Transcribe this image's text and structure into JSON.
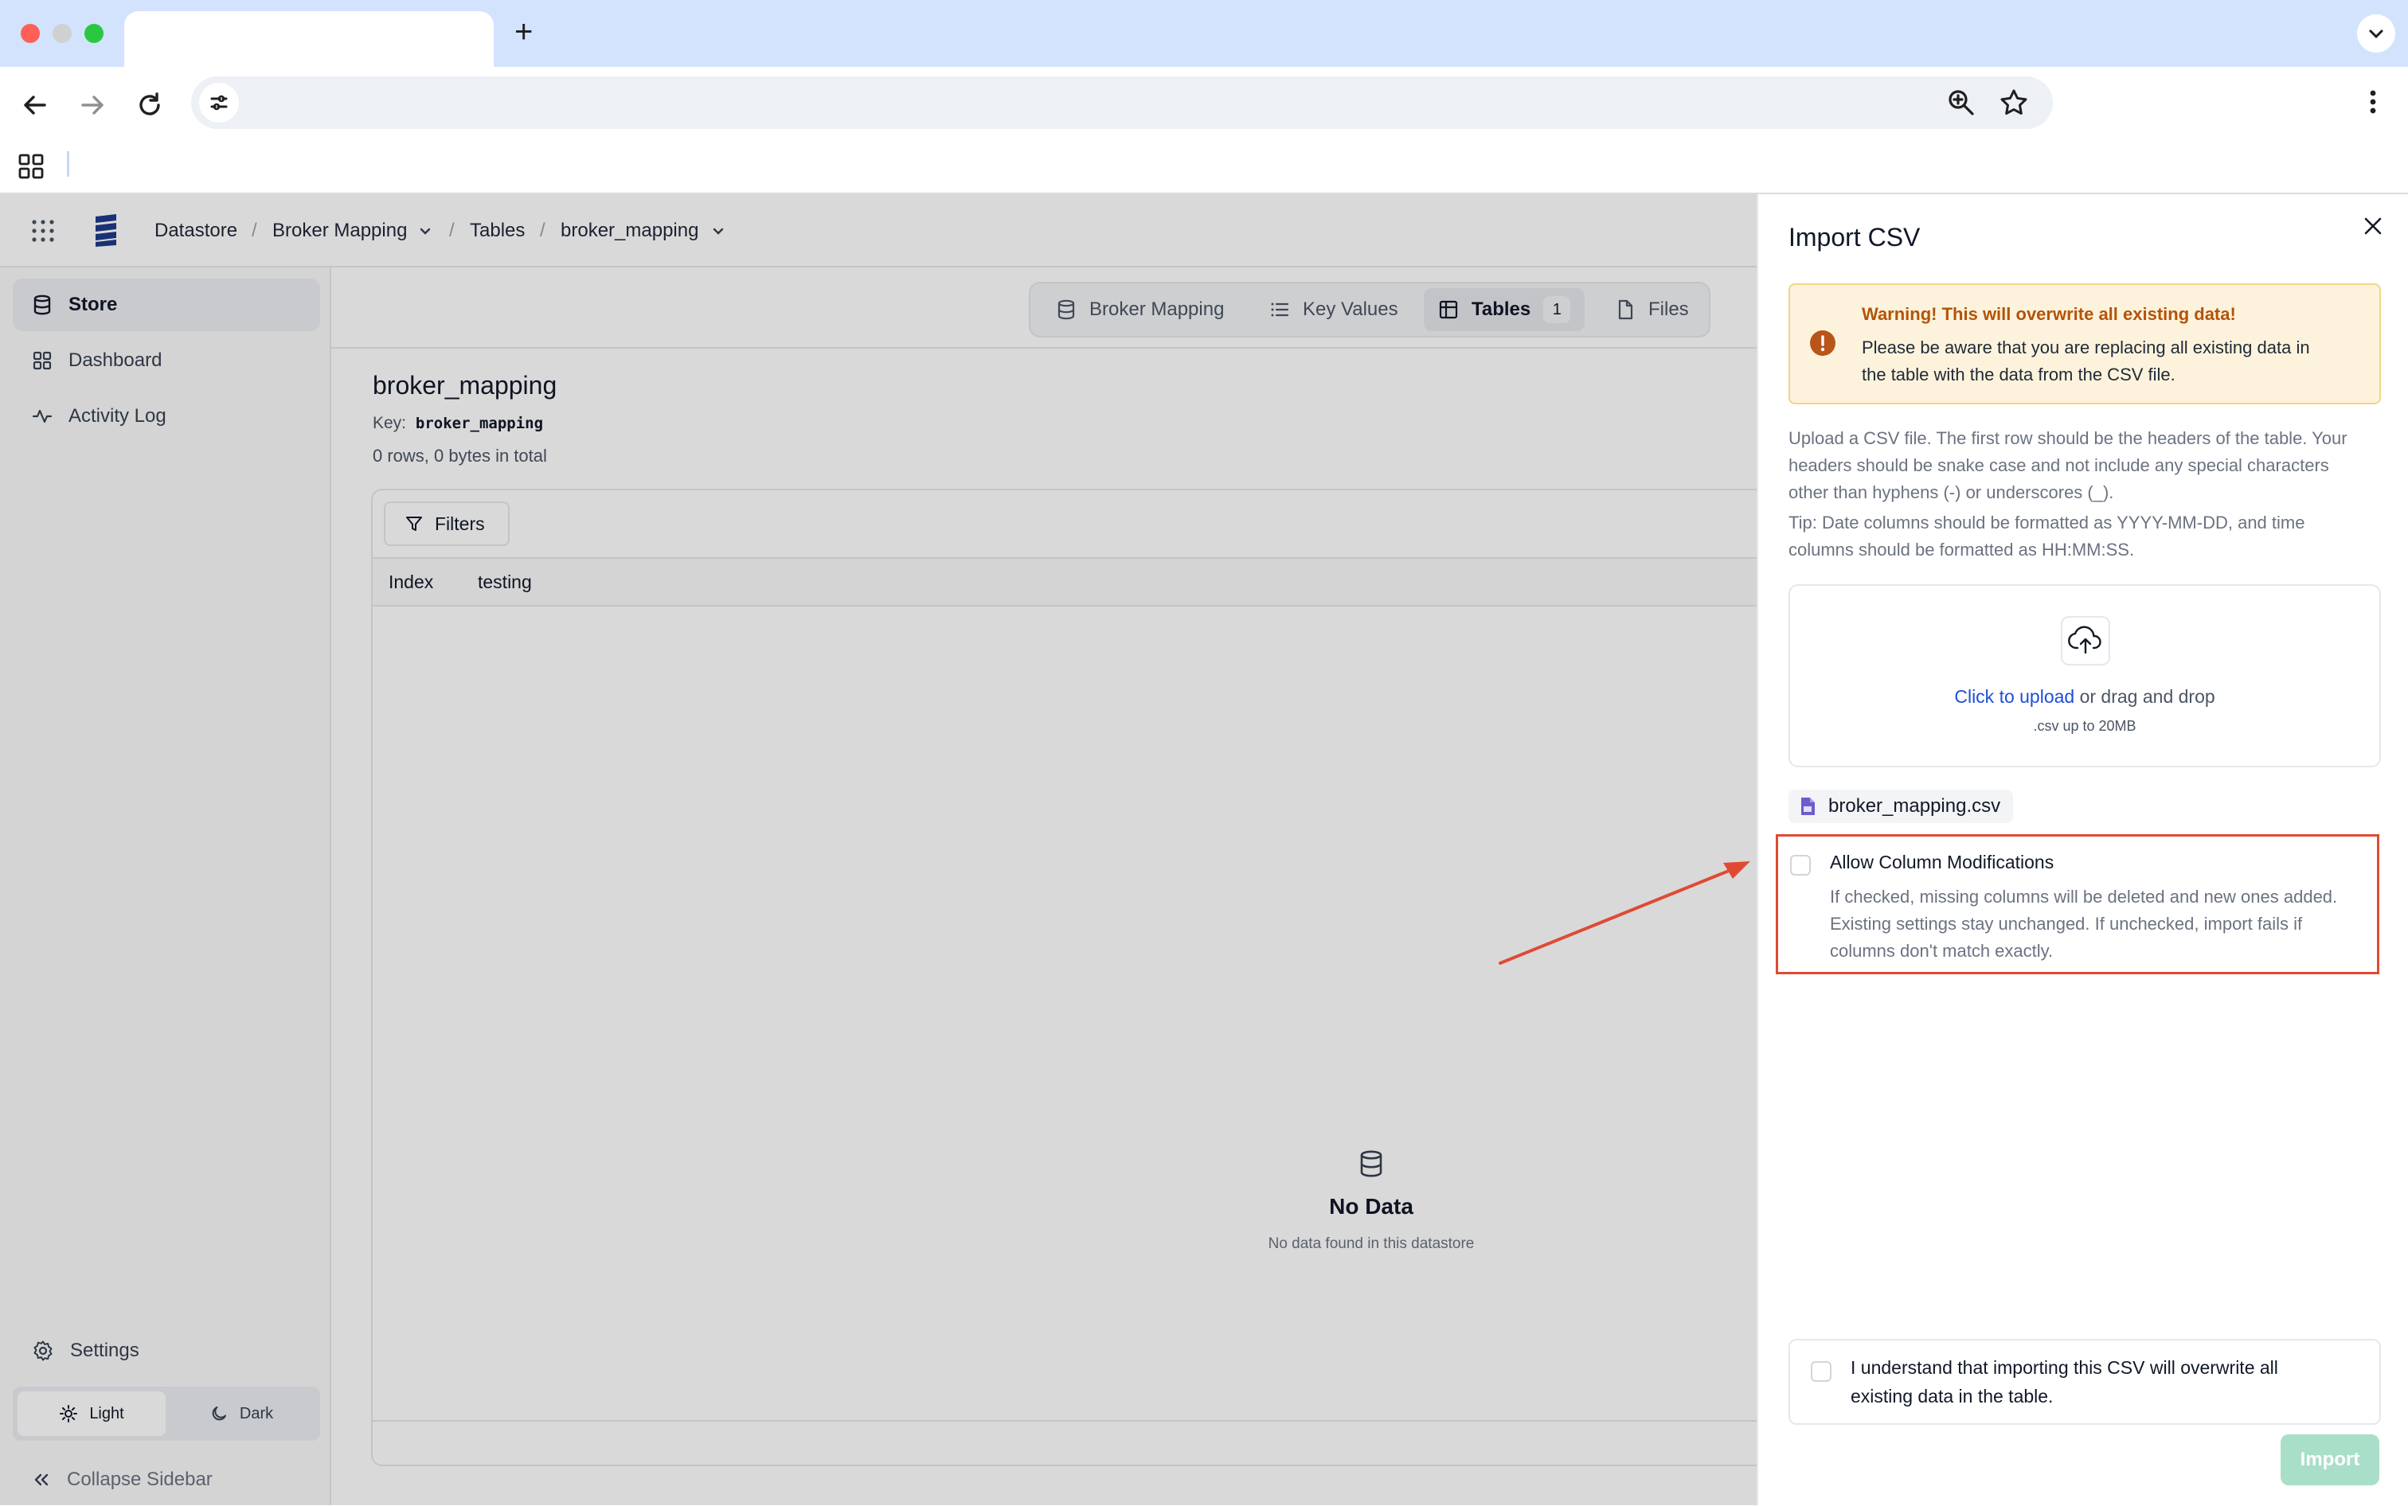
{
  "browser": {
    "new_tab_symbol": "+",
    "icons": [
      "back-icon",
      "forward-icon",
      "reload-icon",
      "site-settings-icon",
      "zoom-icon",
      "bookmark-star-icon",
      "kebab-menu-icon",
      "apps-grid-icon",
      "tab-list-chevron-icon"
    ]
  },
  "topbar": {
    "breadcrumbs": [
      "Datastore",
      "Broker Mapping",
      "Tables",
      "broker_mapping"
    ],
    "separator": "/"
  },
  "sidebar": {
    "items": [
      {
        "label": "Store",
        "icon": "database-icon",
        "active": true
      },
      {
        "label": "Dashboard",
        "icon": "dashboard-grid-icon",
        "active": false
      },
      {
        "label": "Activity Log",
        "icon": "activity-icon",
        "active": false
      }
    ],
    "settings_label": "Settings",
    "theme": {
      "light_label": "Light",
      "dark_label": "Dark",
      "selected": "Light"
    },
    "collapse_label": "Collapse Sidebar"
  },
  "main": {
    "tabs": [
      {
        "label": "Broker Mapping",
        "icon": "database-icon"
      },
      {
        "label": "Key Values",
        "icon": "list-icon"
      },
      {
        "label": "Tables",
        "icon": "table-icon",
        "badge": "1",
        "active": true
      },
      {
        "label": "Files",
        "icon": "file-icon"
      }
    ],
    "title": "broker_mapping",
    "key_label": "Key:",
    "key_value": "broker_mapping",
    "summary": "0 rows, 0 bytes in total",
    "filters_label": "Filters",
    "columns": [
      "Index",
      "testing"
    ],
    "empty_title": "No Data",
    "empty_subtitle": "No data found in this datastore"
  },
  "drawer": {
    "title": "Import CSV",
    "warning_title": "Warning! This will overwrite all existing data!",
    "warning_body_1": "Please be aware that you are replacing all existing data in",
    "warning_body_2": "the table with the data from the CSV file.",
    "instructions_1": "Upload a CSV file. The first row should be the headers of the table. Your",
    "instructions_2": "headers should be snake case and not include any special characters",
    "instructions_3": "other than hyphens (-) or underscores (_).",
    "tip_1": "Tip: Date columns should be formatted as YYYY-MM-DD, and time",
    "tip_2": "columns should be formatted as HH:MM:SS.",
    "upload_link": "Click to upload",
    "upload_rest": " or drag and drop",
    "upload_hint": ".csv up to 20MB",
    "file_name": "broker_mapping.csv",
    "allow_label": "Allow Column Modifications",
    "allow_desc_1": "If checked, missing columns will be deleted and new ones added.",
    "allow_desc_2": "Existing settings stay unchanged. If unchecked, import fails if",
    "allow_desc_3": "columns don't match exactly.",
    "allow_checked": false,
    "ack_1": "I understand that importing this CSV will overwrite all",
    "ack_2": "existing data in the table.",
    "ack_checked": false,
    "import_label": "Import"
  },
  "colors": {
    "accent_green": "#a9dfc8",
    "warning_bg": "#fdf3dc",
    "warning_text": "#b45309",
    "annotation_red": "#e04a33",
    "link_blue": "#1d4ed8"
  }
}
